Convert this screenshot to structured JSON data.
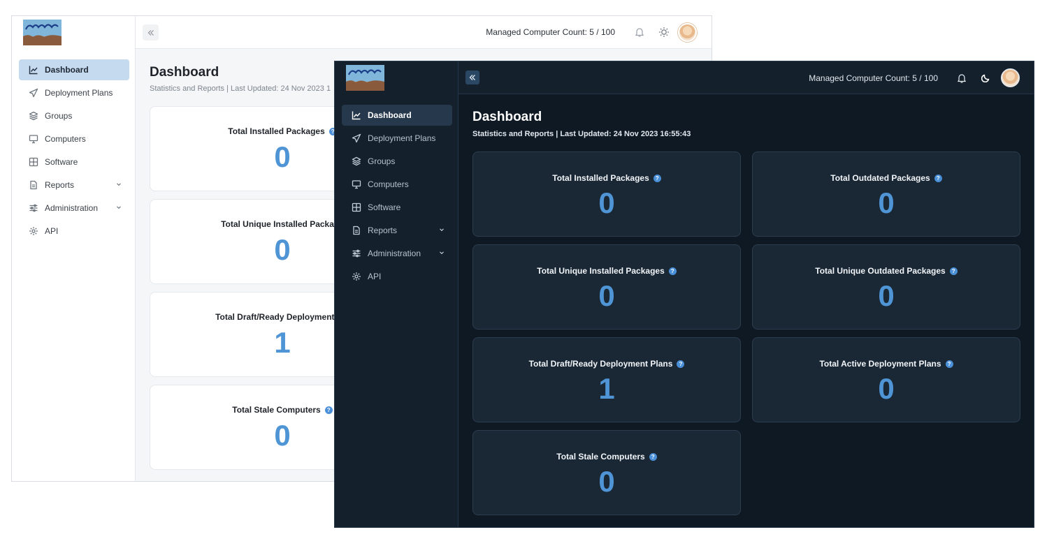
{
  "light": {
    "sidebar": {
      "items": [
        {
          "label": "Dashboard",
          "icon": "line-chart-icon"
        },
        {
          "label": "Deployment Plans",
          "icon": "paper-plane-icon"
        },
        {
          "label": "Groups",
          "icon": "layers-icon"
        },
        {
          "label": "Computers",
          "icon": "monitor-icon"
        },
        {
          "label": "Software",
          "icon": "grid-icon"
        },
        {
          "label": "Reports",
          "icon": "document-icon"
        },
        {
          "label": "Administration",
          "icon": "sliders-icon"
        },
        {
          "label": "API",
          "icon": "gear-icon"
        }
      ]
    },
    "header": {
      "managed_count": "Managed Computer Count: 5 / 100"
    },
    "page": {
      "title": "Dashboard",
      "subtitle": "Statistics and Reports | Last Updated: 24 Nov 2023 1"
    },
    "cards": [
      {
        "label": "Total Installed Packages",
        "value": "0"
      },
      {
        "label": "Total Unique Installed Package",
        "value": "0"
      },
      {
        "label": "Total Draft/Ready Deployment Pla",
        "value": "1"
      },
      {
        "label": "Total Stale Computers",
        "value": "0"
      }
    ]
  },
  "dark": {
    "sidebar": {
      "items": [
        {
          "label": "Dashboard",
          "icon": "line-chart-icon"
        },
        {
          "label": "Deployment Plans",
          "icon": "paper-plane-icon"
        },
        {
          "label": "Groups",
          "icon": "layers-icon"
        },
        {
          "label": "Computers",
          "icon": "monitor-icon"
        },
        {
          "label": "Software",
          "icon": "grid-icon"
        },
        {
          "label": "Reports",
          "icon": "document-icon"
        },
        {
          "label": "Administration",
          "icon": "sliders-icon"
        },
        {
          "label": "API",
          "icon": "gear-icon"
        }
      ]
    },
    "header": {
      "managed_count": "Managed Computer Count: 5 / 100"
    },
    "page": {
      "title": "Dashboard",
      "subtitle": "Statistics and Reports | Last Updated: 24 Nov 2023 16:55:43"
    },
    "cards": [
      {
        "label": "Total Installed Packages",
        "value": "0"
      },
      {
        "label": "Total Outdated Packages",
        "value": "0"
      },
      {
        "label": "Total Unique Installed Packages",
        "value": "0"
      },
      {
        "label": "Total Unique Outdated Packages",
        "value": "0"
      },
      {
        "label": "Total Draft/Ready Deployment Plans",
        "value": "1"
      },
      {
        "label": "Total Active Deployment Plans",
        "value": "0"
      },
      {
        "label": "Total Stale Computers",
        "value": "0"
      }
    ]
  },
  "colors": {
    "accent": "#4f95d6",
    "light_active": "#c5d9ef",
    "dark_bg": "#0f1923",
    "dark_panel": "#1a2734"
  },
  "help_glyph": "?"
}
